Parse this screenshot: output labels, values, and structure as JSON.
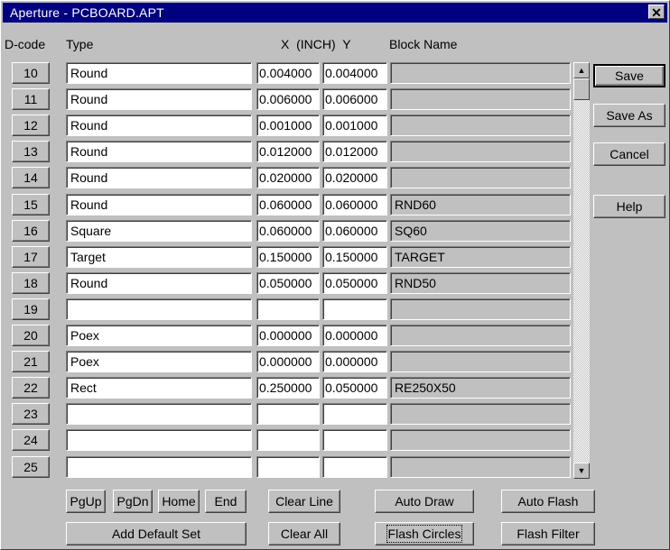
{
  "window": {
    "title": "Aperture - PCBOARD.APT",
    "close_glyph": "✕"
  },
  "headers": {
    "dcode": "D-code",
    "type": "Type",
    "xy": "X  (INCH)  Y",
    "block": "Block Name"
  },
  "rows": [
    {
      "dcode": "10",
      "type": "Round",
      "x": "0.004000",
      "y": "0.004000",
      "block": ""
    },
    {
      "dcode": "11",
      "type": "Round",
      "x": "0.006000",
      "y": "0.006000",
      "block": ""
    },
    {
      "dcode": "12",
      "type": "Round",
      "x": "0.001000",
      "y": "0.001000",
      "block": ""
    },
    {
      "dcode": "13",
      "type": "Round",
      "x": "0.012000",
      "y": "0.012000",
      "block": ""
    },
    {
      "dcode": "14",
      "type": "Round",
      "x": "0.020000",
      "y": "0.020000",
      "block": ""
    },
    {
      "dcode": "15",
      "type": "Round",
      "x": "0.060000",
      "y": "0.060000",
      "block": "RND60"
    },
    {
      "dcode": "16",
      "type": "Square",
      "x": "0.060000",
      "y": "0.060000",
      "block": "SQ60"
    },
    {
      "dcode": "17",
      "type": "Target",
      "x": "0.150000",
      "y": "0.150000",
      "block": "TARGET"
    },
    {
      "dcode": "18",
      "type": "Round",
      "x": "0.050000",
      "y": "0.050000",
      "block": "RND50"
    },
    {
      "dcode": "19",
      "type": "",
      "x": "",
      "y": "",
      "block": ""
    },
    {
      "dcode": "20",
      "type": "Poex",
      "x": "0.000000",
      "y": "0.000000",
      "block": ""
    },
    {
      "dcode": "21",
      "type": "Poex",
      "x": "0.000000",
      "y": "0.000000",
      "block": ""
    },
    {
      "dcode": "22",
      "type": "Rect",
      "x": "0.250000",
      "y": "0.050000",
      "block": "RE250X50"
    },
    {
      "dcode": "23",
      "type": "",
      "x": "",
      "y": "",
      "block": ""
    },
    {
      "dcode": "24",
      "type": "",
      "x": "",
      "y": "",
      "block": ""
    },
    {
      "dcode": "25",
      "type": "",
      "x": "",
      "y": "",
      "block": ""
    }
  ],
  "side_buttons": {
    "save": "Save",
    "save_as": "Save As",
    "cancel": "Cancel",
    "help": "Help"
  },
  "bottom_buttons": {
    "pgup": "PgUp",
    "pgdn": "PgDn",
    "home": "Home",
    "end": "End",
    "add_default_set": "Add Default Set",
    "clear_line": "Clear Line",
    "clear_all": "Clear All",
    "auto_draw": "Auto Draw",
    "flash_circles": "Flash Circles",
    "auto_flash": "Auto Flash",
    "flash_filter": "Flash Filter"
  },
  "scrollbar": {
    "up_glyph": "▲",
    "down_glyph": "▼",
    "position": 0
  },
  "colors": {
    "titlebar": "#000080",
    "face": "#c0c0c0"
  },
  "icons": {
    "close": "close-icon",
    "scroll_up": "scroll-up-arrow-icon",
    "scroll_down": "scroll-down-arrow-icon"
  }
}
